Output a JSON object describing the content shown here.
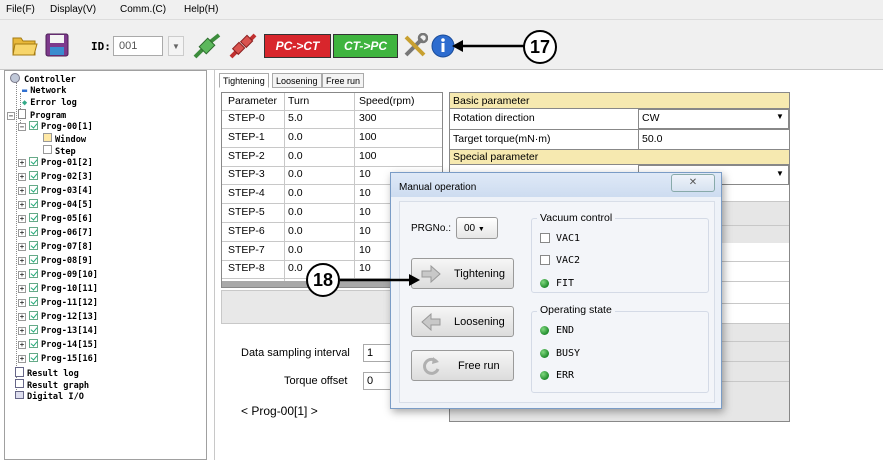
{
  "menu": [
    "File(F)",
    "Display(V)",
    "Comm.(C)",
    "Help(H)"
  ],
  "toolbar": {
    "id_label": "ID:",
    "id_value": "001",
    "pc_ct": "PC->CT",
    "ct_pc": "CT->PC"
  },
  "tree": {
    "controller": "Controller",
    "network": "Network",
    "error_log": "Error log",
    "program": "Program",
    "prog00": "Prog-00[1]",
    "window": "Window",
    "step": "Step",
    "progs": [
      "Prog-01[2]",
      "Prog-02[3]",
      "Prog-03[4]",
      "Prog-04[5]",
      "Prog-05[6]",
      "Prog-06[7]",
      "Prog-07[8]",
      "Prog-08[9]",
      "Prog-09[10]",
      "Prog-10[11]",
      "Prog-11[12]",
      "Prog-12[13]",
      "Prog-13[14]",
      "Prog-14[15]",
      "Prog-15[16]"
    ],
    "result_log": "Result log",
    "result_graph": "Result graph",
    "digital_io": "Digital I/O"
  },
  "tabs": [
    "Tightening",
    "Loosening",
    "Free run"
  ],
  "step_table": {
    "headers": [
      "Parameter",
      "Turn",
      "Speed(rpm)"
    ],
    "rows": [
      [
        "STEP-0",
        "5.0",
        "300"
      ],
      [
        "STEP-1",
        "0.0",
        "100"
      ],
      [
        "STEP-2",
        "0.0",
        "100"
      ],
      [
        "STEP-3",
        "0.0",
        "10"
      ],
      [
        "STEP-4",
        "0.0",
        "10"
      ],
      [
        "STEP-5",
        "0.0",
        "10"
      ],
      [
        "STEP-6",
        "0.0",
        "10"
      ],
      [
        "STEP-7",
        "0.0",
        "10"
      ],
      [
        "STEP-8",
        "0.0",
        "10"
      ]
    ]
  },
  "params": {
    "basic": "Basic parameter",
    "rotation_label": "Rotation direction",
    "rotation_value": "CW",
    "torque_label": "Target torque(mN·m)",
    "torque_value": "50.0",
    "special": "Special parameter"
  },
  "bottom": {
    "sampling_label": "Data sampling interval",
    "sampling_value": "1",
    "offset_label": "Torque offset",
    "offset_value": "0",
    "prog_name": "< Prog-00[1] >"
  },
  "dialog": {
    "title": "Manual operation",
    "prg_label": "PRGNo.:",
    "prg_value": "00",
    "tightening": "Tightening",
    "loosening": "Loosening",
    "free_run": "Free run",
    "vacuum": "Vacuum control",
    "vac1": "VAC1",
    "vac2": "VAC2",
    "fit": "FIT",
    "opstate": "Operating state",
    "end": "END",
    "busy": "BUSY",
    "err": "ERR"
  },
  "callouts": {
    "c17": "17",
    "c18": "18"
  }
}
